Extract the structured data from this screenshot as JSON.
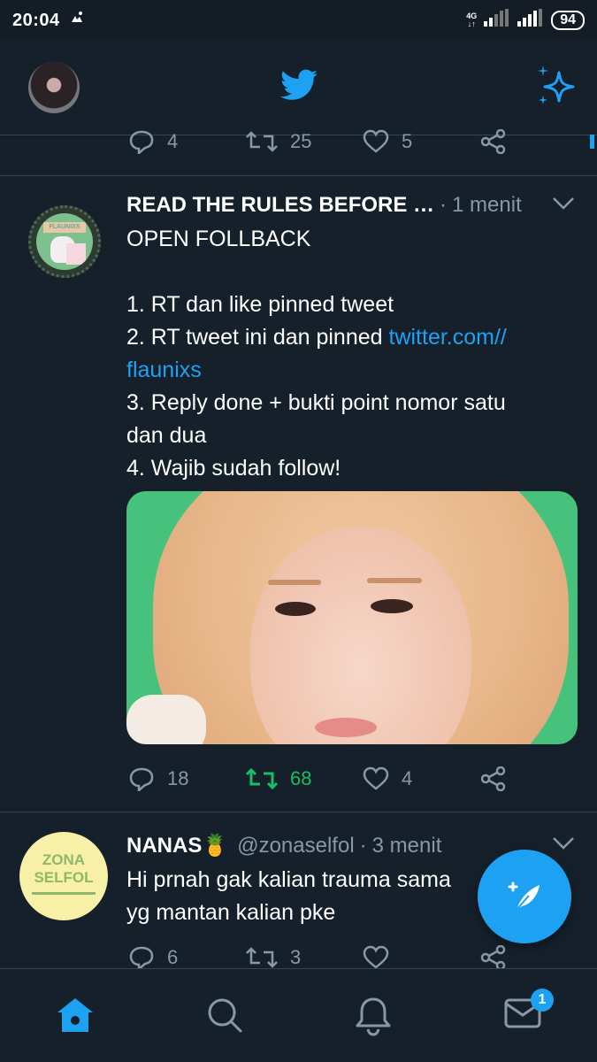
{
  "status_bar": {
    "time": "20:04",
    "network": "4G",
    "battery": "94"
  },
  "header": {
    "logo": "twitter-bird-icon",
    "sparkle": "sparkle-icon"
  },
  "prev_tweet": {
    "replies": "4",
    "retweets": "25",
    "likes": "5"
  },
  "tweet1": {
    "name": "READ THE RULES BEFORE …",
    "dot": "·",
    "time": "1 menit",
    "line1": "OPEN FOLLBACK",
    "line2": "1. RT dan like pinned tweet",
    "line3a": "2. RT tweet ini dan pinned ",
    "link1": "twitter.com//",
    "link2": "flaunixs",
    "line4": "3. Reply done + bukti point nomor satu",
    "line5": "dan dua",
    "line6": "4. Wajib sudah follow!",
    "avatar_label": "FLAUNIXS",
    "replies": "18",
    "retweets": "68",
    "likes": "4",
    "retweet_color": "#17bf63"
  },
  "tweet2": {
    "name": "NANAS🍍",
    "handle": "@zonaselfol",
    "dot": "·",
    "time": "3 menit",
    "line1": "Hi prnah gak kalian trauma sama",
    "line2": "yg mantan kalian pke",
    "avatar_line1": "ZONA",
    "avatar_line2": "SELFOL",
    "replies": "6",
    "retweets": "3",
    "likes": ""
  },
  "bottom_nav": {
    "items": [
      "home-icon",
      "search-icon",
      "bell-icon",
      "mail-icon"
    ],
    "mail_badge": "1"
  },
  "colors": {
    "background": "#15202b",
    "accent": "#1da1f2",
    "muted": "#8899a6"
  }
}
